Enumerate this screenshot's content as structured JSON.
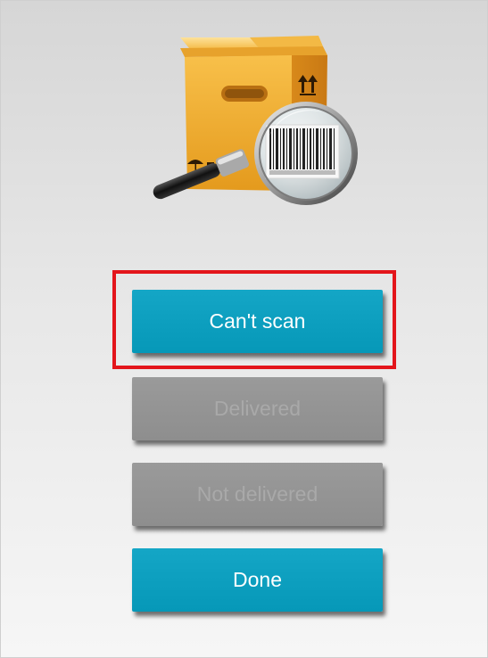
{
  "illustration": {
    "icon": "package-barcode-search-icon"
  },
  "actions": {
    "cant_scan_label": "Can't scan",
    "delivered_label": "Delivered",
    "not_delivered_label": "Not delivered",
    "done_label": "Done"
  },
  "colors": {
    "primary": "#0698b8",
    "disabled": "#939393",
    "disabled_text": "#a9a9a9",
    "highlight": "#e3151b"
  }
}
